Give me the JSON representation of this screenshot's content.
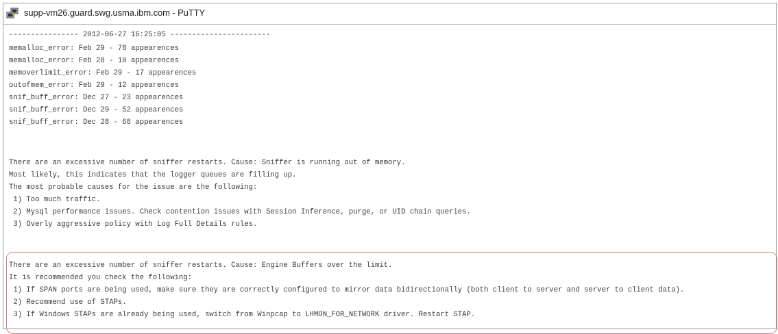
{
  "window": {
    "title": "supp-vm26.guard.swg.usma.ibm.com - PuTTY",
    "icon": "putty-terminal-icon"
  },
  "terminal": {
    "lines": [
      "---------------- 2012-06-27 16:25:05 -----------------------",
      "memalloc_error: Feb 29 - 78 appearences",
      "memalloc_error: Feb 28 - 10 appearences",
      "memoverlimit_error: Feb 29 - 17 appearences",
      "outofmem_error: Feb 29 - 12 appearences",
      "snif_buff_error: Dec 27 - 23 appearences",
      "snif_buff_error: Dec 29 - 52 appearences",
      "snif_buff_error: Dec 28 - 68 appearences",
      "There are an excessive number of sniffer restarts. Cause: Sniffer is running out of memory.",
      "Most likely, this indicates that the logger queues are filling up.",
      "The most probable causes for the issue are the following:",
      " 1) Too much traffic.",
      " 2) Mysql performance issues. Check contention issues with Session Inference, purge, or UID chain queries.",
      " 3) Overly aggressive policy with Log Full Details rules.",
      "There are an excessive number of sniffer restarts. Cause: Engine Buffers over the limit.",
      "It is recommended you check the following:",
      " 1) If SPAN ports are being used, make sure they are correctly configured to mirror data bidirectionally (both client to server and server to client data).",
      " 2) Recommend use of STAPs.",
      " 3) If Windows STAPs are already being used, switch from Winpcap to LHMON_FOR_NETWORK driver. Restart STAP."
    ]
  },
  "colors": {
    "highlight_border": "#d2807e",
    "terminal_text": "#3c3c3c",
    "terminal_background": "#ffffff"
  }
}
